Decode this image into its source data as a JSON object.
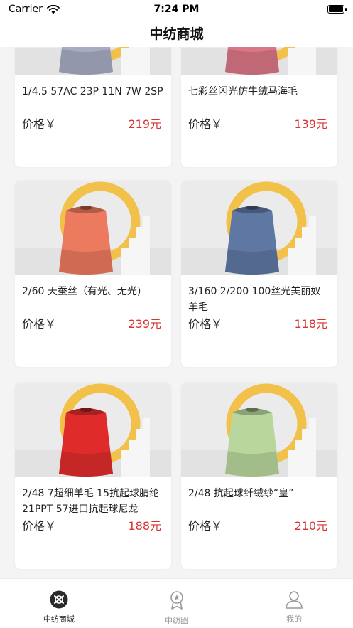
{
  "status_bar": {
    "carrier": "Carrier",
    "time": "7:24 PM",
    "battery_level": 1.0
  },
  "nav": {
    "title": "中纺商城"
  },
  "products": [
    {
      "name": "1/4.5 57AC 23P 11N 7W 2SP",
      "price_label": "价格￥",
      "price": "219元",
      "yarn_color": "#a7acc4"
    },
    {
      "name": "七彩丝闪光仿牛绒马海毛",
      "price_label": "价格￥",
      "price": "139元",
      "yarn_color": "#db7686"
    },
    {
      "name": "2/60 天蚕丝（有光、无光)",
      "price_label": "价格￥",
      "price": "239元",
      "yarn_color": "#ec7a5e"
    },
    {
      "name": "3/160 2/200 100丝光美丽奴羊毛",
      "price_label": "价格￥",
      "price": "118元",
      "yarn_color": "#5f77a3"
    },
    {
      "name": "2/48 7超细羊毛 15抗起球腈纶 21PPT 57进口抗起球尼龙",
      "price_label": "价格￥",
      "price": "188元",
      "yarn_color": "#df2c2a"
    },
    {
      "name": "2/48 抗起球纤绒纱“皇”",
      "price_label": "价格￥",
      "price": "210元",
      "yarn_color": "#b9d79d"
    }
  ],
  "tabs": [
    {
      "label": "中纺商城",
      "icon": "shop-logo-icon",
      "active": true
    },
    {
      "label": "中纺圈",
      "icon": "medal-icon",
      "active": false
    },
    {
      "label": "我的",
      "icon": "person-icon",
      "active": false
    }
  ]
}
